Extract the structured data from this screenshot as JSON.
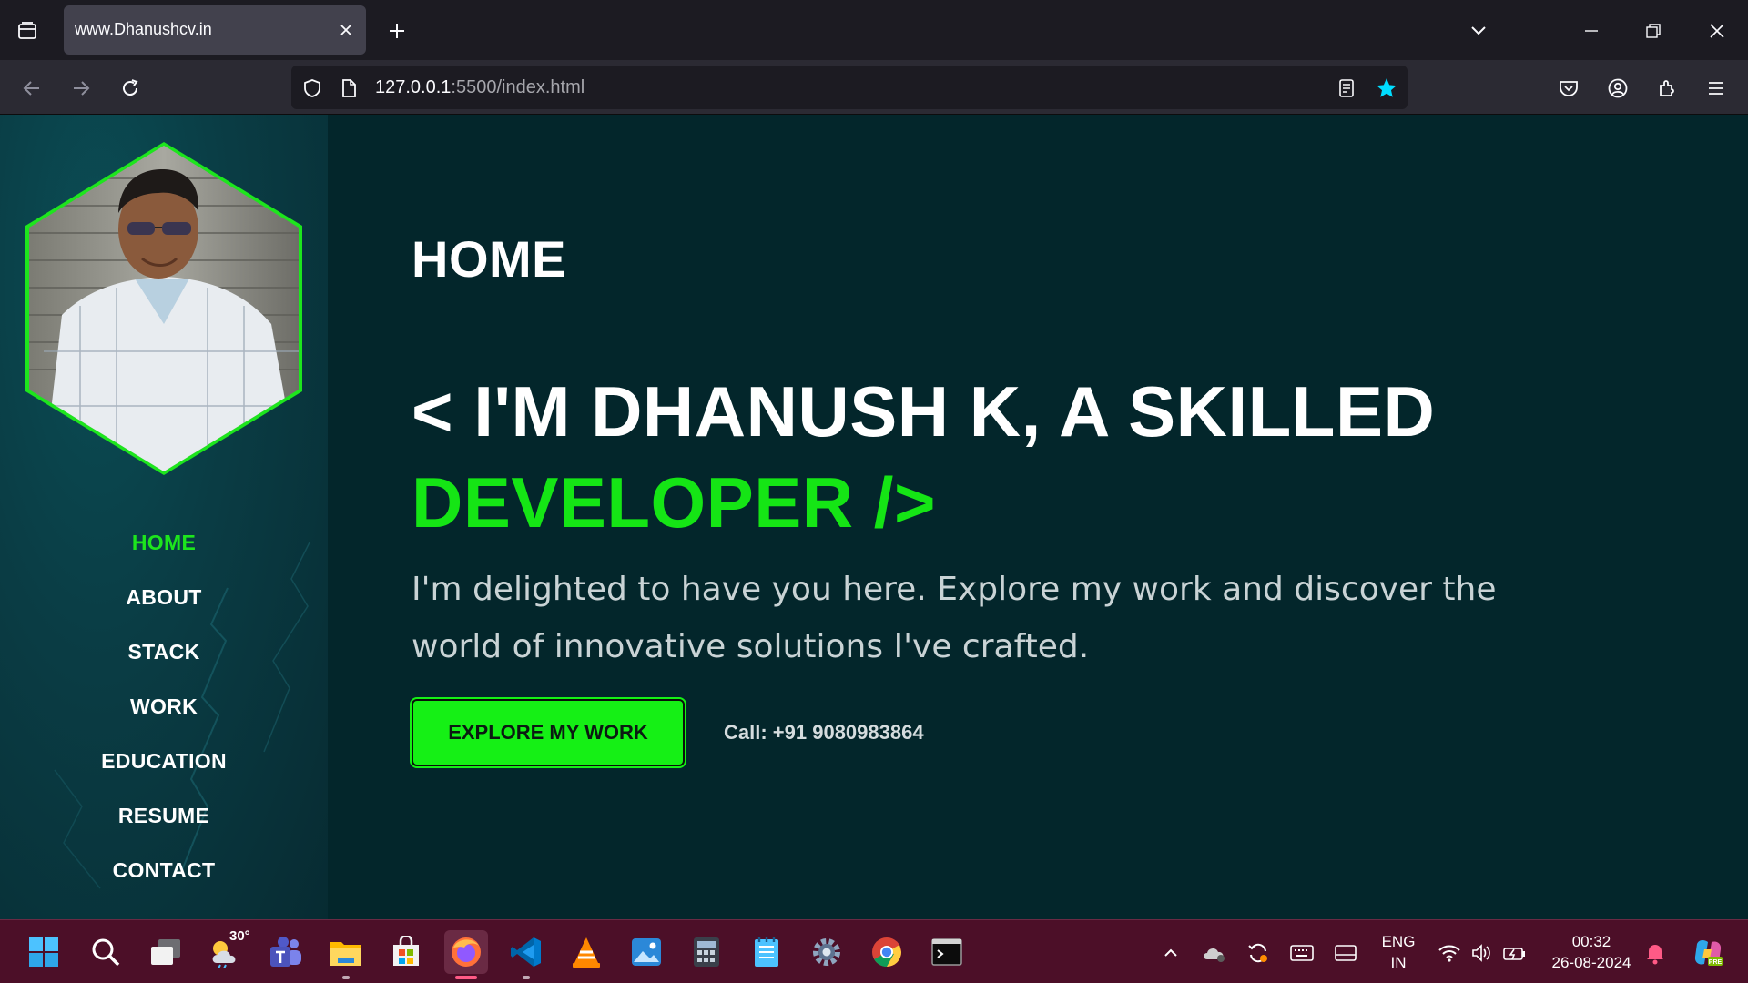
{
  "browser": {
    "tab_title": "www.Dhanushcv.in",
    "url_host": "127.0.0.1",
    "url_path": ":5500/index.html"
  },
  "sidebar": {
    "nav": [
      {
        "label": "HOME",
        "active": true
      },
      {
        "label": "ABOUT",
        "active": false
      },
      {
        "label": "STACK",
        "active": false
      },
      {
        "label": "WORK",
        "active": false
      },
      {
        "label": "EDUCATION",
        "active": false
      },
      {
        "label": "RESUME",
        "active": false
      },
      {
        "label": "CONTACT",
        "active": false
      }
    ]
  },
  "hero": {
    "section_title": "HOME",
    "headline_line1": "< I'M DHANUSH K, A SKILLED",
    "headline_line2": "DEVELOPER />",
    "tagline": "I'm delighted to have you here. Explore my work and discover the world of innovative solutions I've crafted.",
    "cta_label": "EXPLORE MY WORK",
    "phone": "Call: +91 9080983864"
  },
  "taskbar": {
    "weather_temp": "30°",
    "lang_line1": "ENG",
    "lang_line2": "IN",
    "time": "00:32",
    "date": "26-08-2024"
  },
  "colors": {
    "accent_green": "#15e515",
    "page_bg": "#03262b",
    "taskbar_bg": "#4c0f28"
  }
}
